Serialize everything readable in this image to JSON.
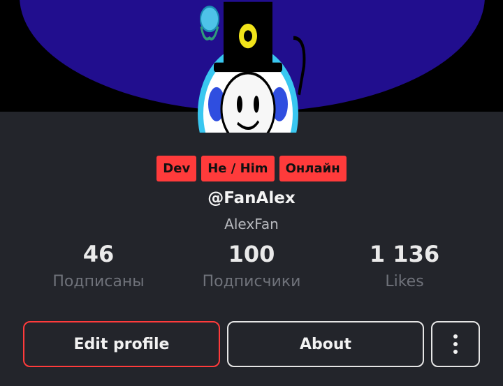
{
  "badges": [
    "Dev",
    "He / Him",
    "Онлайн"
  ],
  "profile": {
    "handle": "@FanAlex",
    "display_name": "AlexFan"
  },
  "stats": [
    {
      "value": "46",
      "label": "Подписаны"
    },
    {
      "value": "100",
      "label": "Подписчики"
    },
    {
      "value": "1 136",
      "label": "Likes"
    }
  ],
  "actions": {
    "edit_label": "Edit profile",
    "about_label": "About",
    "more_icon": "more-vertical-icon"
  },
  "colors": {
    "accent": "#ff3b3b",
    "panel": "#23252b",
    "banner": "#210e8e"
  }
}
